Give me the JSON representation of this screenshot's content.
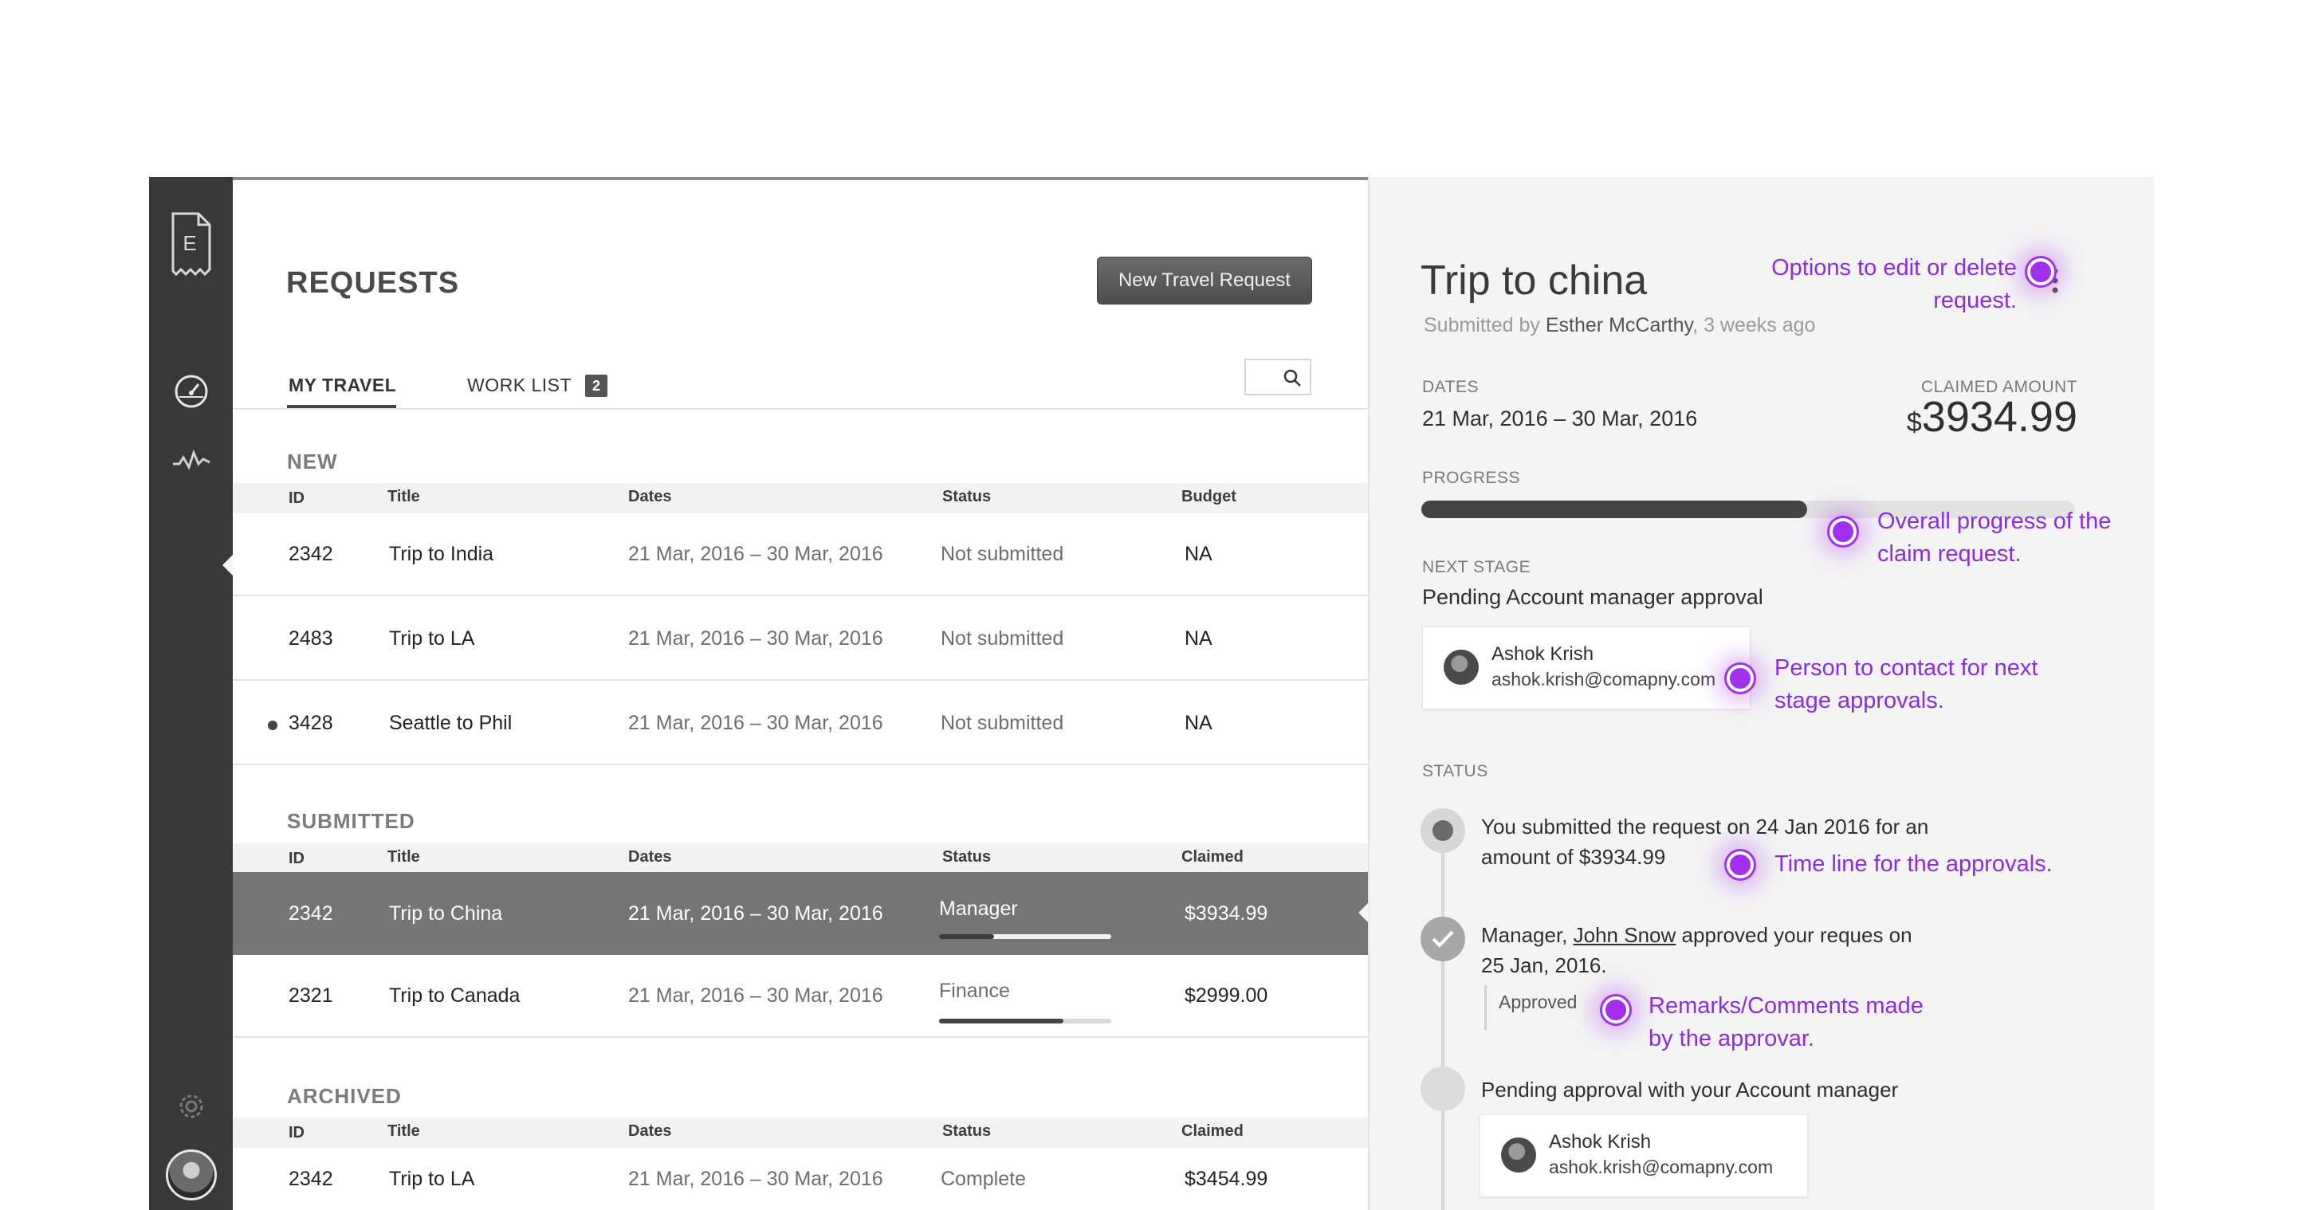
{
  "app": {
    "logo_letter": "E"
  },
  "header": {
    "title": "REQUESTS",
    "new_button": "New Travel Request"
  },
  "tabs": [
    {
      "label": "MY TRAVEL",
      "active": true
    },
    {
      "label": "WORK LIST",
      "badge": "2"
    }
  ],
  "sections": {
    "new": {
      "label": "NEW",
      "columns": [
        "ID",
        "Title",
        "Dates",
        "Status",
        "Budget"
      ],
      "rows": [
        {
          "id": "2342",
          "title": "Trip to India",
          "dates": "21 Mar, 2016 – 30 Mar, 2016",
          "status": "Not submitted",
          "value": "NA"
        },
        {
          "id": "2483",
          "title": "Trip to LA",
          "dates": "21 Mar, 2016 – 30 Mar, 2016",
          "status": "Not submitted",
          "value": "NA"
        },
        {
          "id": "3428",
          "title": "Seattle to Phil",
          "dates": "21 Mar, 2016 – 30 Mar, 2016",
          "status": "Not submitted",
          "value": "NA",
          "unread": true
        }
      ]
    },
    "submitted": {
      "label": "SUBMITTED",
      "columns": [
        "ID",
        "Title",
        "Dates",
        "Status",
        "Claimed"
      ],
      "rows": [
        {
          "id": "2342",
          "title": "Trip to China",
          "dates": "21 Mar, 2016 – 30 Mar, 2016",
          "status": "Manager",
          "value": "$3934.99",
          "progress": 0.32,
          "selected": true
        },
        {
          "id": "2321",
          "title": "Trip to Canada",
          "dates": "21 Mar, 2016 – 30 Mar, 2016",
          "status": "Finance",
          "value": "$2999.00",
          "progress": 0.72
        }
      ]
    },
    "archived": {
      "label": "ARCHIVED",
      "columns": [
        "ID",
        "Title",
        "Dates",
        "Status",
        "Claimed"
      ],
      "rows": [
        {
          "id": "2342",
          "title": "Trip to LA",
          "dates": "21 Mar, 2016 – 30 Mar, 2016",
          "status": "Complete",
          "value": "$3454.99"
        }
      ]
    }
  },
  "detail": {
    "title": "Trip to china",
    "submitted_prefix": "Submitted by",
    "submitted_by": "Esther McCarthy",
    "submitted_when": ", 3 weeks ago",
    "dates_label": "DATES",
    "dates": "21 Mar, 2016 – 30 Mar, 2016",
    "claimed_label": "CLAIMED AMOUNT",
    "currency": "$",
    "claimed_amount": "3934.99",
    "progress_label": "PROGRESS",
    "progress": 0.59,
    "next_stage_label": "NEXT STAGE",
    "next_stage": "Pending Account manager approval",
    "contact": {
      "name": "Ashok Krish",
      "email": "ashok.krish@comapny.com"
    },
    "status_label": "STATUS",
    "timeline": {
      "submitted_line1": "You submitted the request on 24 Jan 2016 for an",
      "submitted_line2": "amount of $3934.99",
      "approved_prefix": "Manager, ",
      "approved_name": "John Snow",
      "approved_suffix": " approved your reques on",
      "approved_line2": "25 Jan, 2016.",
      "remark": "Approved",
      "pending": "Pending approval with your Account manager",
      "pending_contact": {
        "name": "Ashok Krish",
        "email": "ashok.krish@comapny.com"
      }
    }
  },
  "annotations": {
    "options": [
      "Options to edit or delete",
      "request."
    ],
    "progress": [
      "Overall progress of the",
      "claim request."
    ],
    "contact": [
      "Person to contact for next",
      "stage approvals."
    ],
    "timeline": [
      "Time line for the approvals."
    ],
    "remarks": [
      "Remarks/Comments made",
      "by the approvar."
    ]
  },
  "colors": {
    "annotation": "#8c2be2",
    "sidebar": "#383838",
    "selected_row": "#757575"
  }
}
